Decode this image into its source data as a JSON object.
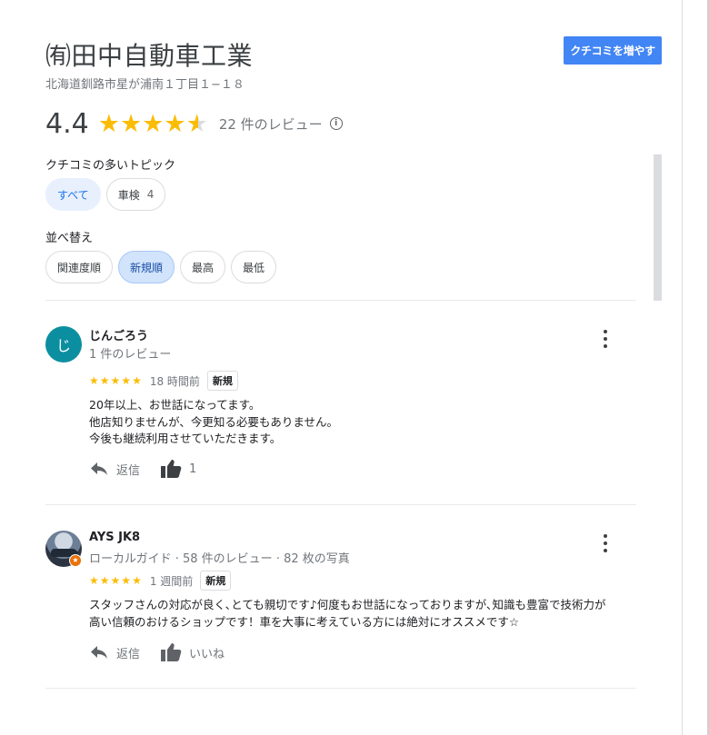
{
  "business": {
    "name": "㈲田中自動車工業",
    "address": "北海道釧路市星が浦南１丁目１−１８"
  },
  "write_review_button": "クチコミを増やす",
  "rating": {
    "value": "4.4",
    "stars": 4.4,
    "count_text": "22 件のレビュー",
    "info_icon": "i"
  },
  "topics": {
    "label": "クチコミの多いトピック",
    "chips": [
      {
        "label": "すべて"
      },
      {
        "label": "車検",
        "count": "4"
      }
    ]
  },
  "sort": {
    "label": "並べ替え",
    "options": [
      {
        "label": "関連度順"
      },
      {
        "label": "新規順"
      },
      {
        "label": "最高"
      },
      {
        "label": "最低"
      }
    ],
    "selected": "新規順"
  },
  "reviews": [
    {
      "avatar_letter": "じ",
      "name": "じんごろう",
      "meta": "1 件のレビュー",
      "stars": 5,
      "time": "18 時間前",
      "badge": "新規",
      "text_lines": [
        "20年以上、お世話になってます。",
        "他店知りませんが、今更知る必要もありません。",
        "今後も継続利用させていただきます。"
      ],
      "reply_label": "返信",
      "like_label": "1"
    },
    {
      "name": "AYS JK8",
      "meta": "ローカルガイド · 58 件のレビュー · 82 枚の写真",
      "guide_badge": "★",
      "stars": 5,
      "time": "1 週間前",
      "badge": "新規",
      "text_lines": [
        "スタッフさんの対応が良く､とても親切です♪何度もお世話になっておりますが､知識も豊富で技術力が",
        "高い信頼のおけるショップです！車を大事に考えている方には絶対にオススメです☆"
      ],
      "reply_label": "返信",
      "like_label": "いいね"
    }
  ],
  "colors": {
    "accent": "#4285f4",
    "star": "#fbbc04",
    "avatar_teal": "#0b8fa0",
    "guide_orange": "#e8710a"
  },
  "icons": {
    "reply": "reply-arrow-icon",
    "like": "thumbs-up-icon",
    "more": "more-vert-icon"
  }
}
